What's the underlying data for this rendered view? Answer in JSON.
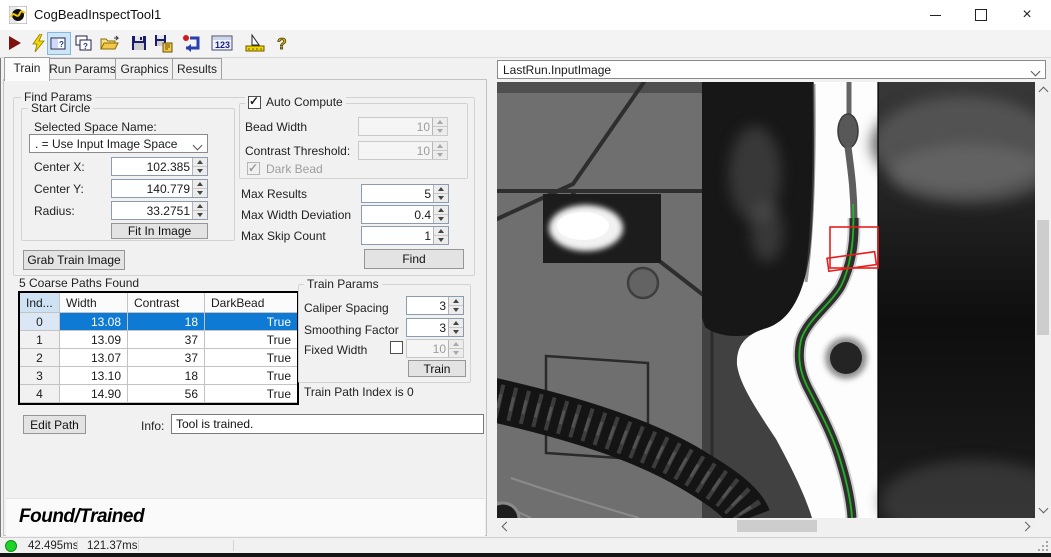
{
  "window": {
    "title": "CogBeadInspectTool1"
  },
  "toolbar": {
    "icons": [
      "run",
      "run-electric",
      "show-image-page-toggle",
      "show-controls-toggle",
      "open-file",
      "save-file",
      "save-subset",
      "reset",
      "numeric-results",
      "profile-tool",
      "help"
    ],
    "glyph_123": "123",
    "glyph_help": "?"
  },
  "tabs": {
    "train": "Train",
    "run_params": "Run Params",
    "graphics": "Graphics",
    "results": "Results"
  },
  "find_params": {
    "title": "Find Params",
    "start_circle": {
      "title": "Start Circle",
      "space_label": "Selected Space Name:",
      "space_value": ". = Use Input Image Space",
      "center_x_label": "Center X:",
      "center_x": "102.385",
      "center_y_label": "Center Y:",
      "center_y": "140.779",
      "radius_label": "Radius:",
      "radius": "33.2751",
      "fit_button": "Fit In Image"
    },
    "auto_compute": {
      "label": "Auto Compute",
      "bead_width_label": "Bead Width",
      "bead_width": "10",
      "contrast_label": "Contrast Threshold:",
      "contrast": "10",
      "dark_bead_label": "Dark Bead"
    },
    "max_results_label": "Max Results",
    "max_results": "5",
    "max_width_dev_label": "Max Width Deviation",
    "max_width_dev": "0.4",
    "max_skip_label": "Max Skip Count",
    "max_skip": "1",
    "find_button": "Find"
  },
  "grab_train_button": "Grab Train Image",
  "paths_table": {
    "caption": "5 Coarse Paths Found",
    "col_index": "Ind...",
    "col_width": "Width",
    "col_contrast": "Contrast",
    "col_darkbead": "DarkBead",
    "rows": [
      [
        "0",
        "13.08",
        "18",
        "True"
      ],
      [
        "1",
        "13.09",
        "37",
        "True"
      ],
      [
        "2",
        "13.07",
        "37",
        "True"
      ],
      [
        "3",
        "13.10",
        "18",
        "True"
      ],
      [
        "4",
        "14.90",
        "56",
        "True"
      ]
    ],
    "selected_row": 0
  },
  "train_params": {
    "title": "Train Params",
    "caliper_label": "Caliper Spacing",
    "caliper": "3",
    "smoothing_label": "Smoothing Factor",
    "smoothing": "3",
    "fixed_width_label": "Fixed Width",
    "fixed_width": "10",
    "train_button": "Train",
    "status": "Train Path Index is 0"
  },
  "footer": {
    "edit_path_button": "Edit Path",
    "info_label": "Info:",
    "info_value": "Tool is trained.",
    "result_banner": "Found/Trained"
  },
  "status_bar": {
    "time1": "42.495ms",
    "time2": "121.37ms"
  },
  "image_panel": {
    "selector": "LastRun.InputImage"
  },
  "colors": {
    "selection": "#0e7ad4",
    "green_path": "#21b421",
    "red_overlay": "#e51f1f",
    "status_ok": "#1fd32a"
  }
}
